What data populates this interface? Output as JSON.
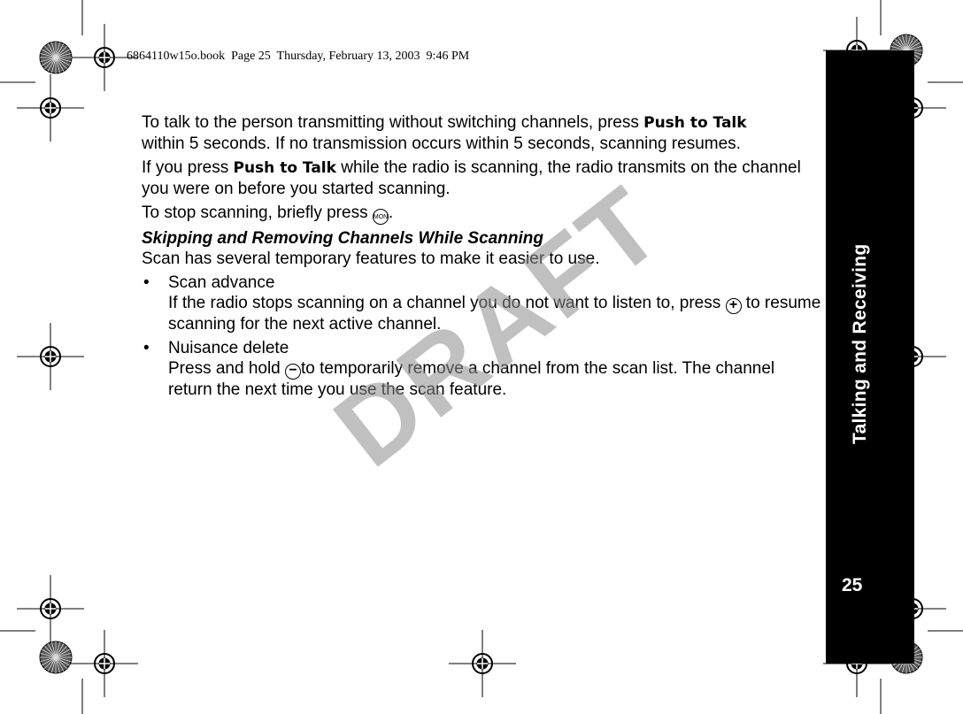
{
  "header": "6864110w15o.book  Page 25  Thursday, February 13, 2003  9:46 PM",
  "sidebar": {
    "title": "Talking and Receiving",
    "page_number": "25"
  },
  "watermark": "DRAFT",
  "body": {
    "p1": {
      "a": "To talk to the person transmitting without switching channels, press ",
      "key": "Push to Talk",
      "b": " within 5 seconds. If no transmission occurs within 5 seconds, scanning resumes."
    },
    "p2": {
      "a": "If you press ",
      "key": "Push to Talk",
      "b": " while the radio is scanning, the radio transmits on the channel you were on before you started scanning."
    },
    "p3": {
      "a": "To stop scanning, briefly press ",
      "icon_label": "MON",
      "b": "."
    },
    "heading": "Skipping and Removing Channels While Scanning",
    "intro": "Scan has several temporary features to make it easier to use.",
    "bullets": [
      {
        "title": "Scan advance",
        "a": "If the radio stops scanning on a channel you do not want to listen to, press ",
        "icon": "plus-button-icon",
        "b": " to resume scanning for the next active channel."
      },
      {
        "title": "Nuisance delete",
        "a": "Press and hold ",
        "icon": "minus-button-icon",
        "b": "to temporarily remove a channel from the scan list. The channel return the next time you use the scan feature."
      }
    ]
  }
}
